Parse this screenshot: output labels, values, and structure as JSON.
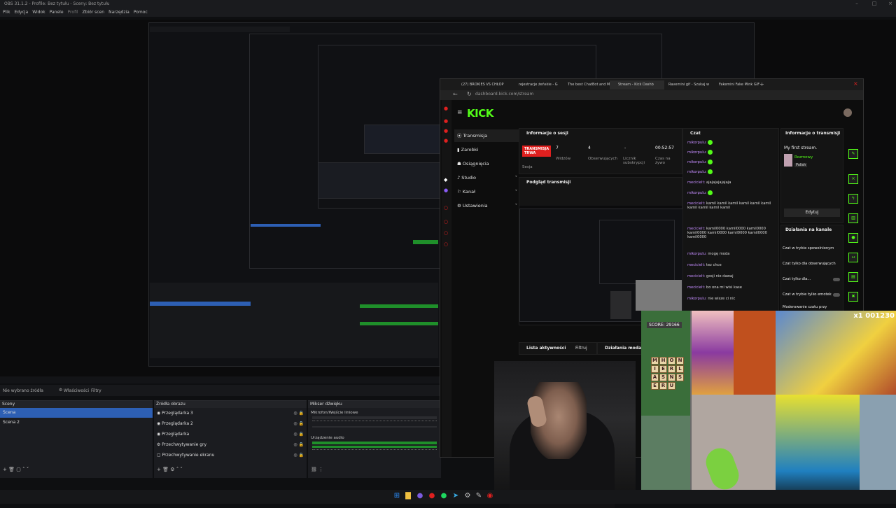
{
  "obs": {
    "title": "OBS 31.1.2 - Profile: Bez tytułu - Sceny: Bez tytułu",
    "menu": [
      "Plik",
      "Edycja",
      "Widok",
      "Panele",
      "Profil",
      "Zbiór scen",
      "Narzędzia",
      "Pomoc"
    ],
    "no_source": "Nie wybrano źródła",
    "properties": "Właściwości",
    "filters": "Filtry",
    "scenes_title": "Sceny",
    "scenes": [
      "Scena",
      "Scena 2"
    ],
    "sources_title": "Źródła obrazu",
    "sources": [
      "Przeglądarka 3",
      "Przeglądarka 2",
      "Przeglądarka",
      "Przechwytywanie gry",
      "Przechwytywanie ekranu"
    ],
    "mixer_title": "Mikser dźwięku",
    "mixer": [
      "Mikrofon/Wejście liniowe",
      "Urządzenie audio"
    ]
  },
  "browser": {
    "tabs": [
      "(27) BROKIES VS CHŁOP",
      "rejestracje żeńskie - G",
      "The best ChatBot and M",
      "Stream - Kick Dashb",
      "Ravemini gif - Szukaj w",
      "Fakemini Fake Mink GIF"
    ],
    "url": "dashboard.kick.com/stream"
  },
  "kick": {
    "logo": "KICK",
    "nav": [
      "Transmisja",
      "Zarobki",
      "Osiągnięcia",
      "Studio",
      "Kanał",
      "Ustawienia"
    ],
    "session": {
      "title": "Informacje o sesji",
      "live_label_1": "TRANSMISJA",
      "live_label_2": "TRWA",
      "live_sub": "Sesja",
      "stats": [
        {
          "v": "7",
          "l": "Widzów"
        },
        {
          "v": "4",
          "l": "Obserwujących"
        },
        {
          "v": "-",
          "l": "Licznik subskrypcji"
        },
        {
          "v": "00:52:57",
          "l": "Czas na żywo"
        }
      ]
    },
    "preview_title": "Podgląd transmisji",
    "activity": "Lista aktywności",
    "filter": "Filtruj",
    "mod_actions": "Działania moda",
    "chat": {
      "title": "Czat",
      "messages": [
        {
          "u": "mikorpulu:",
          "t": ""
        },
        {
          "u": "mikorpulu:",
          "t": ""
        },
        {
          "u": "mikorpulu:",
          "t": ""
        },
        {
          "u": "mikorpulu:",
          "t": ""
        },
        {
          "u": "mecicielt:",
          "t": "ajajajajajajaja"
        },
        {
          "u": "mikorpulu:",
          "t": ""
        },
        {
          "u": "mecicielt:",
          "t": "kamil kamil kamil kamil kamil kamil kamil kamil kamil kamil"
        },
        {
          "u": "mecicielt:",
          "t": "kamil0000 kamil0000 kamil0000 kamil0000 kamil0000 kamil0000 kamil0000 kamil0000"
        },
        {
          "u": "mikorpulu:",
          "t": "mogę moda"
        },
        {
          "u": "mecicielt:",
          "t": "tez chce"
        },
        {
          "u": "mecicielt:",
          "t": "gosji nie dawaj"
        },
        {
          "u": "mecicielt:",
          "t": "bo ona mi wisi kase"
        },
        {
          "u": "mikorpulu:",
          "t": "nie wisze ci nic"
        }
      ]
    },
    "stream_info": {
      "title": "Informacje o transmisji",
      "stream_title": "My first stream.",
      "category": "Rozmowy",
      "lang": "Polish",
      "edit": "Edytuj"
    },
    "channel_actions": {
      "title": "Działania na kanale",
      "items": [
        "Czat w trybie spowolnionym",
        "Czat tylko dla obserwujących",
        "Czat tylko dla...",
        "Czat w trybie tylko emotek",
        "Moderowanie czatu przy"
      ]
    }
  },
  "game": {
    "score": "SCORE: 29166",
    "timer": "x1  001230",
    "letters": [
      "M",
      "H",
      "O",
      "N",
      "I",
      "E",
      "R",
      "L",
      "A",
      "S",
      "N",
      "S",
      "E",
      "R",
      "U"
    ]
  }
}
